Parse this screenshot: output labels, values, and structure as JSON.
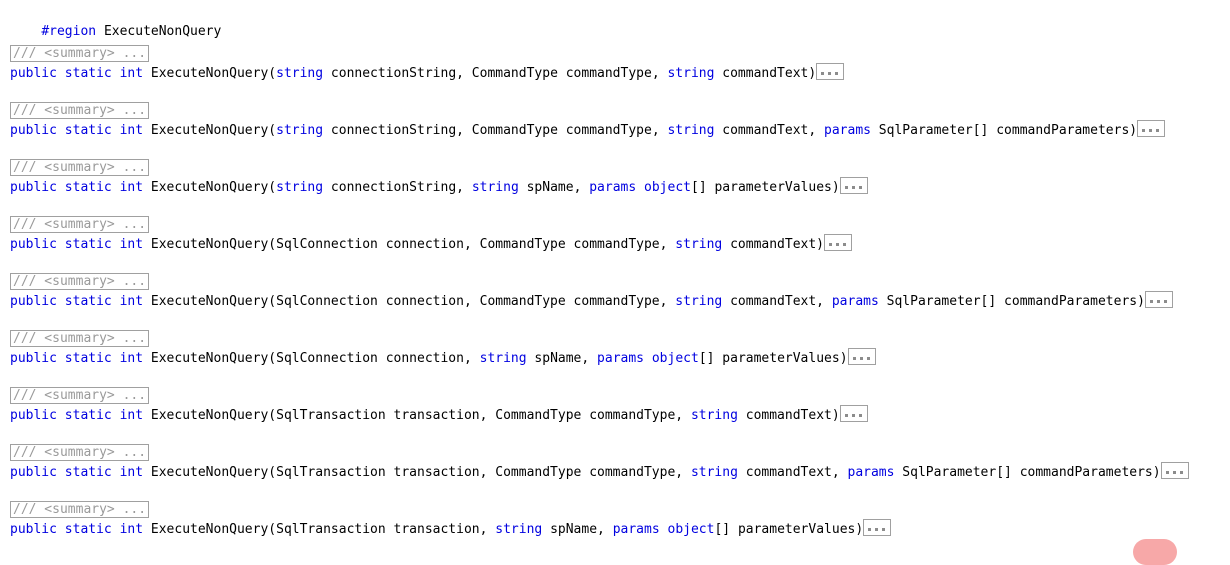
{
  "editor": {
    "language": "csharp",
    "background_color": "#ffffff",
    "keyword_color": "#0000E0",
    "identifier_color": "#000000",
    "collapsed_text_color": "#9a9a9a",
    "collapsed_border_color": "#a0a0a0",
    "accent_pill_color": "#f7a8a8",
    "region_directive": {
      "keyword": "#region",
      "name": "ExecuteNonQuery"
    },
    "collapsed_doc_label": "/// <summary> ...",
    "collapsed_body_label": "...",
    "overloads": [
      {
        "doc": "/// <summary> ...",
        "modifiers": "public static int ",
        "name": "ExecuteNonQuery(",
        "tokens": [
          {
            "t": "string",
            "k": true
          },
          {
            "t": " connectionString, CommandType commandType, ",
            "k": false
          },
          {
            "t": "string",
            "k": true
          },
          {
            "t": " commandText)",
            "k": false
          }
        ]
      },
      {
        "doc": "/// <summary> ...",
        "modifiers": "public static int ",
        "name": "ExecuteNonQuery(",
        "tokens": [
          {
            "t": "string",
            "k": true
          },
          {
            "t": " connectionString, CommandType commandType, ",
            "k": false
          },
          {
            "t": "string",
            "k": true
          },
          {
            "t": " commandText, ",
            "k": false
          },
          {
            "t": "params",
            "k": true
          },
          {
            "t": " SqlParameter[] commandParameters)",
            "k": false
          }
        ]
      },
      {
        "doc": "/// <summary> ...",
        "modifiers": "public static int ",
        "name": "ExecuteNonQuery(",
        "tokens": [
          {
            "t": "string",
            "k": true
          },
          {
            "t": " connectionString, ",
            "k": false
          },
          {
            "t": "string",
            "k": true
          },
          {
            "t": " spName, ",
            "k": false
          },
          {
            "t": "params",
            "k": true
          },
          {
            "t": " ",
            "k": false
          },
          {
            "t": "object",
            "k": true
          },
          {
            "t": "[] parameterValues)",
            "k": false
          }
        ]
      },
      {
        "doc": "/// <summary> ...",
        "modifiers": "public static int ",
        "name": "ExecuteNonQuery(",
        "tokens": [
          {
            "t": "SqlConnection connection, CommandType commandType, ",
            "k": false
          },
          {
            "t": "string",
            "k": true
          },
          {
            "t": " commandText)",
            "k": false
          }
        ]
      },
      {
        "doc": "/// <summary> ...",
        "modifiers": "public static int ",
        "name": "ExecuteNonQuery(",
        "tokens": [
          {
            "t": "SqlConnection connection, CommandType commandType, ",
            "k": false
          },
          {
            "t": "string",
            "k": true
          },
          {
            "t": " commandText, ",
            "k": false
          },
          {
            "t": "params",
            "k": true
          },
          {
            "t": " SqlParameter[] commandParameters)",
            "k": false
          }
        ]
      },
      {
        "doc": "/// <summary> ...",
        "modifiers": "public static int ",
        "name": "ExecuteNonQuery(",
        "tokens": [
          {
            "t": "SqlConnection connection, ",
            "k": false
          },
          {
            "t": "string",
            "k": true
          },
          {
            "t": " spName, ",
            "k": false
          },
          {
            "t": "params",
            "k": true
          },
          {
            "t": " ",
            "k": false
          },
          {
            "t": "object",
            "k": true
          },
          {
            "t": "[] parameterValues)",
            "k": false
          }
        ]
      },
      {
        "doc": "/// <summary> ...",
        "modifiers": "public static int ",
        "name": "ExecuteNonQuery(",
        "tokens": [
          {
            "t": "SqlTransaction transaction, CommandType commandType, ",
            "k": false
          },
          {
            "t": "string",
            "k": true
          },
          {
            "t": " commandText)",
            "k": false
          }
        ]
      },
      {
        "doc": "/// <summary> ...",
        "modifiers": "public static int ",
        "name": "ExecuteNonQuery(",
        "tokens": [
          {
            "t": "SqlTransaction transaction, CommandType commandType, ",
            "k": false
          },
          {
            "t": "string",
            "k": true
          },
          {
            "t": " commandText, ",
            "k": false
          },
          {
            "t": "params",
            "k": true
          },
          {
            "t": " SqlParameter[] commandParameters)",
            "k": false
          }
        ]
      },
      {
        "doc": "/// <summary> ...",
        "modifiers": "public static int ",
        "name": "ExecuteNonQuery(",
        "tokens": [
          {
            "t": "SqlTransaction transaction, ",
            "k": false
          },
          {
            "t": "string",
            "k": true
          },
          {
            "t": " spName, ",
            "k": false
          },
          {
            "t": "params",
            "k": true
          },
          {
            "t": " ",
            "k": false
          },
          {
            "t": "object",
            "k": true
          },
          {
            "t": "[] parameterValues)",
            "k": false
          }
        ]
      }
    ]
  }
}
